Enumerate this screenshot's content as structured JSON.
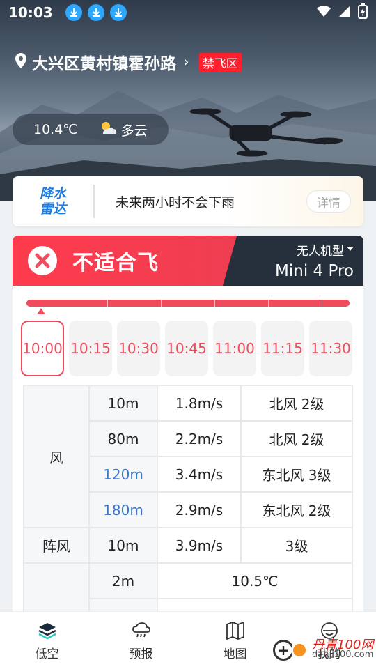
{
  "status_bar": {
    "time": "10:03"
  },
  "location": {
    "text": "大兴区黄村镇霍孙路",
    "badge": "禁飞区"
  },
  "weather": {
    "temperature": "10.4℃",
    "description": "多云",
    "icon": "partly-cloudy-icon"
  },
  "radar": {
    "logo_line1": "降水",
    "logo_line2": "雷达",
    "message": "未来两小时不会下雨",
    "detail_label": "详情"
  },
  "verdict": {
    "text": "不适合飞",
    "model_label": "无人机型",
    "model_name": "Mini 4 Pro"
  },
  "times": [
    "10:00",
    "10:15",
    "10:30",
    "10:45",
    "11:00",
    "11:15",
    "11:30"
  ],
  "table": {
    "wind": {
      "label": "风",
      "rows": [
        {
          "alt": "10m",
          "speed": "1.8m/s",
          "direction": "北风 2级"
        },
        {
          "alt": "80m",
          "speed": "2.2m/s",
          "direction": "北风 2级"
        },
        {
          "alt": "120m",
          "speed": "3.4m/s",
          "direction": "东北风 3级"
        },
        {
          "alt": "180m",
          "speed": "2.9m/s",
          "direction": "东北风 2级"
        }
      ]
    },
    "gust": {
      "label": "阵风",
      "alt": "10m",
      "speed": "3.9m/s",
      "level": "3级"
    },
    "temp": {
      "alt": "2m",
      "value": "10.5℃"
    }
  },
  "nav": [
    {
      "label": "低空",
      "icon": "layers-icon"
    },
    {
      "label": "预报",
      "icon": "cloud-rain-icon"
    },
    {
      "label": "地图",
      "icon": "map-icon"
    },
    {
      "label": "我的",
      "icon": "profile-icon"
    }
  ],
  "watermark": {
    "line1": "丹青100网",
    "line2": "danji100.com"
  },
  "colors": {
    "accent": "#f04b5c",
    "dark": "#26303c",
    "blue_text": "#3a78c8"
  }
}
